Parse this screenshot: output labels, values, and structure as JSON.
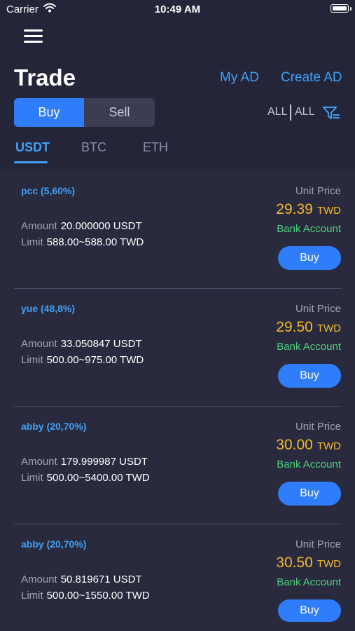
{
  "status_bar": {
    "carrier": "Carrier",
    "time": "10:49 AM"
  },
  "header": {
    "title": "Trade",
    "my_ad": "My AD",
    "create_ad": "Create AD"
  },
  "mode": {
    "buy_label": "Buy",
    "sell_label": "Sell",
    "selected": "Buy"
  },
  "filters": {
    "first": "ALL",
    "second": "ALL"
  },
  "tabs": [
    {
      "label": "USDT",
      "active": true
    },
    {
      "label": "BTC",
      "active": false
    },
    {
      "label": "ETH",
      "active": false
    }
  ],
  "labels": {
    "amount": "Amount",
    "limit": "Limit",
    "unit_price": "Unit Price",
    "currency": "TWD",
    "buy": "Buy"
  },
  "listings": [
    {
      "seller": "pcc (5,60%)",
      "amount": "20.000000 USDT",
      "limit": "588.00~588.00 TWD",
      "price": "29.39",
      "payment": "Bank Account"
    },
    {
      "seller": "yue (48,8%)",
      "amount": "33.050847 USDT",
      "limit": "500.00~975.00 TWD",
      "price": "29.50",
      "payment": "Bank Account"
    },
    {
      "seller": "abby (20,70%)",
      "amount": "179.999987 USDT",
      "limit": "500.00~5400.00 TWD",
      "price": "30.00",
      "payment": "Bank Account"
    },
    {
      "seller": "abby (20,70%)",
      "amount": "50.819671 USDT",
      "limit": "500.00~1550.00 TWD",
      "price": "30.50",
      "payment": "Bank Account"
    }
  ],
  "colors": {
    "accent": "#2f7dfa",
    "link": "#3fa0f5",
    "price": "#f2b92e",
    "payment": "#4dd07a",
    "background": "#2a2a3e",
    "header": "#25253a"
  }
}
